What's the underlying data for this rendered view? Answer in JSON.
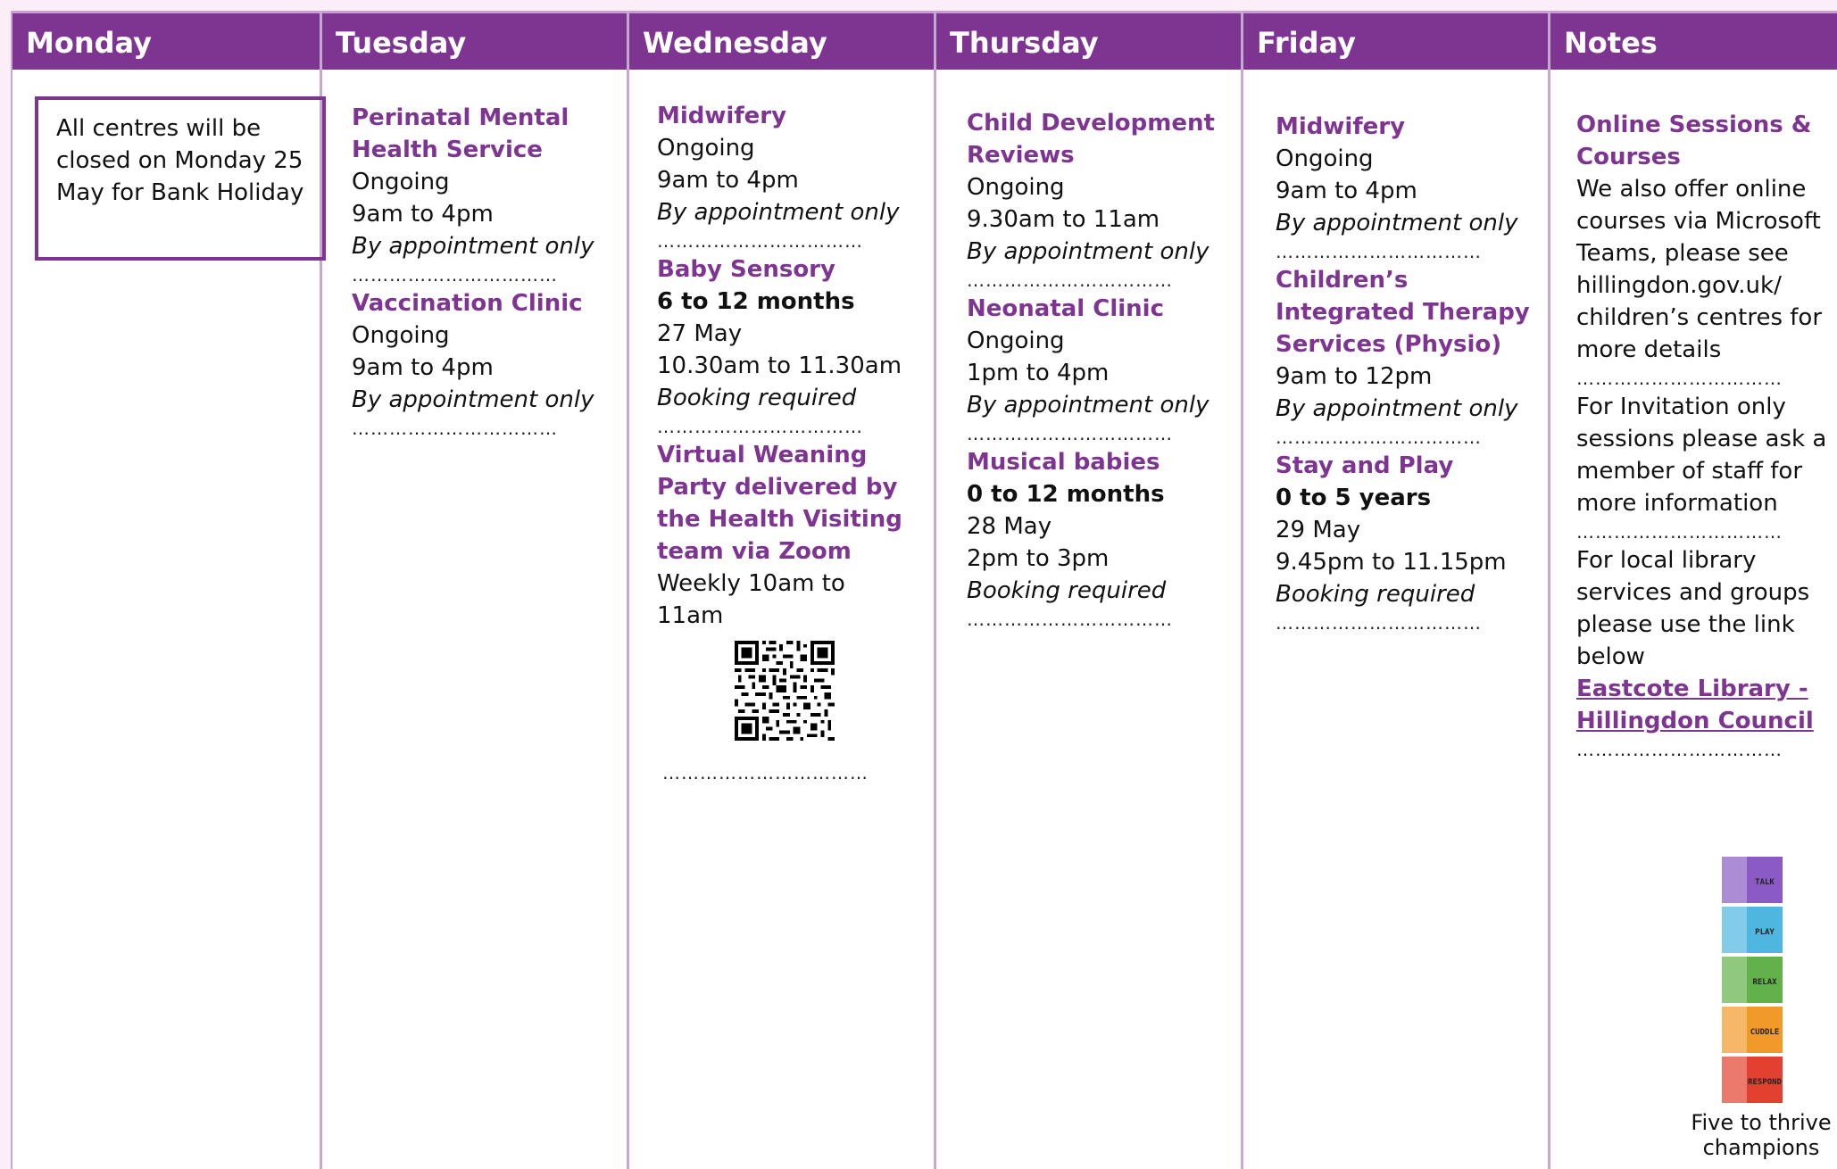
{
  "days": {
    "monday": "Monday",
    "tuesday": "Tuesday",
    "wednesday": "Wednesday",
    "thursday": "Thursday",
    "friday": "Friday",
    "notes": "Notes"
  },
  "monday": {
    "notice": "All centres will be closed on Monday 25 May for Bank Holiday"
  },
  "tuesday": {
    "e1": {
      "title": "Perinatal Mental Health Service",
      "l1": "Ongoing",
      "l2": "9am to 4pm",
      "l3": "By appointment only"
    },
    "e2": {
      "title": "Vaccination Clinic",
      "l1": "Ongoing",
      "l2": "9am to 4pm",
      "l3": "By appointment only"
    }
  },
  "wednesday": {
    "e1": {
      "title": "Midwifery",
      "l1": "Ongoing",
      "l2": "9am to 4pm",
      "l3": "By appointment only"
    },
    "e2": {
      "title": "Baby Sensory",
      "age": "6 to 12 months",
      "l1": "27 May",
      "l2": "10.30am to 11.30am",
      "l3": "Booking required"
    },
    "e3": {
      "title": "Virtual Weaning Party delivered by the Health Visiting team via Zoom",
      "l1": "Weekly 10am to 11am"
    }
  },
  "thursday": {
    "e1": {
      "title": "Child Development Reviews",
      "l1": "Ongoing",
      "l2": "9.30am to 11am",
      "l3": "By appointment only"
    },
    "e2": {
      "title": "Neonatal Clinic",
      "l1": "Ongoing",
      "l2": "1pm to 4pm",
      "l3": "By appointment only"
    },
    "e3": {
      "title": "Musical babies",
      "age": "0 to 12 months",
      "l1": "28 May",
      "l2": "2pm to 3pm",
      "l3": "Booking required"
    }
  },
  "friday": {
    "e1": {
      "title": "Midwifery",
      "l1": "Ongoing",
      "l2": "9am to 4pm",
      "l3": "By appointment only"
    },
    "e2": {
      "title": "Children’s Integrated Therapy Services (Physio)",
      "l1": "9am to 12pm",
      "l2": "By appointment only"
    },
    "e3": {
      "title": "Stay and Play",
      "age": "0 to 5 years",
      "l1": "29 May",
      "l2": "9.45pm to 11.15pm",
      "l3": "Booking required"
    }
  },
  "notes": {
    "e1": {
      "title": "Online Sessions & Courses",
      "text": "We also offer online courses via Microsoft Teams, please see hillingdon.gov.uk/ children’s centres for more details"
    },
    "e2": {
      "text": "For Invitation only sessions please ask a member of staff for more information"
    },
    "e3": {
      "text": "For local library services and groups please use the link below",
      "link": "Eastcote Library - Hillingdon Council"
    }
  },
  "logo": {
    "caption": "Five to thrive champions",
    "blocks": [
      {
        "label": "TALK",
        "color": "#8a5bc4"
      },
      {
        "label": "PLAY",
        "color": "#4fb6e0"
      },
      {
        "label": "RELAX",
        "color": "#62b14a"
      },
      {
        "label": "CUDDLE",
        "color": "#f19a2a"
      },
      {
        "label": "RESPOND",
        "color": "#e2412f"
      }
    ]
  },
  "separator": "……………………………"
}
